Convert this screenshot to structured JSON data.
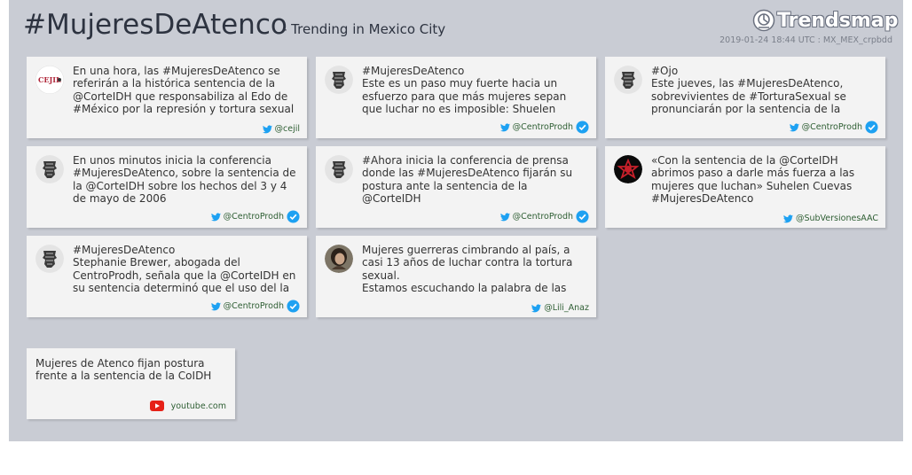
{
  "header": {
    "hashtag": "#MujeresDeAtenco",
    "subtitle": "- Trending in Mexico City",
    "logo_text": "Trendsmap",
    "meta": "2019-01-24 18:44 UTC : MX_MEX_crpbdd"
  },
  "tweets": [
    {
      "avatar": "cejil-logo",
      "lines": [
        " En una hora, las #MujeresDeAtenco se",
        "referirán a la histórica sentencia de la",
        "@CorteIDH que responsabiliza al Edo de",
        "#México por la represión y tortura sexual"
      ],
      "handle": "@cejil",
      "verified": false
    },
    {
      "avatar": "centroprodh-logo",
      "lines": [
        "#MujeresDeAtenco",
        "Este es un paso muy fuerte hacia un",
        "esfuerzo para que más mujeres sepan",
        "que luchar no es imposible: Shuelen"
      ],
      "handle": "@CentroProdh",
      "verified": true
    },
    {
      "avatar": "centroprodh-logo",
      "lines": [
        "#Ojo",
        "Este jueves, las #MujeresDeAtenco,",
        "sobrevivientes de #TorturaSexual se",
        "pronunciarán por la sentencia de la"
      ],
      "handle": "@CentroProdh",
      "verified": true
    },
    {
      "avatar": "centroprodh-logo",
      "lines": [
        "En unos minutos inicia la conferencia",
        "#MujeresDeAtenco, sobre la sentencia de",
        "la @CorteIDH sobre los hechos del 3 y 4",
        "de mayo de 2006"
      ],
      "handle": "@CentroProdh",
      "verified": true
    },
    {
      "avatar": "centroprodh-logo",
      "lines": [
        "#Ahora inicia la conferencia de prensa",
        "donde las #MujeresDeAtenco fijarán su",
        "postura ante la sentencia de la",
        "@CorteIDH"
      ],
      "handle": "@CentroProdh",
      "verified": true
    },
    {
      "avatar": "subversiones-logo",
      "lines": [
        "«Con la sentencia de la @CorteIDH",
        "abrimos paso a darle más fuerza a las",
        "mujeres que luchan» Suhelen Cuevas",
        "#MujeresDeAtenco"
      ],
      "handle": "@SubVersionesAAC",
      "verified": false
    },
    {
      "avatar": "centroprodh-logo",
      "lines": [
        "#MujeresDeAtenco",
        "Stephanie Brewer, abogada del",
        "CentroProdh, señala que la @CorteIDH en",
        "su sentencia determinó que el uso del la"
      ],
      "handle": "@CentroProdh",
      "verified": true
    },
    {
      "avatar": "user-photo",
      "lines": [
        "Mujeres guerreras cimbrando al país, a",
        "casi 13 años de luchar contra la tortura",
        "sexual.",
        "Estamos escuchando la palabra de las"
      ],
      "handle": "@Lili_Anaz",
      "verified": false
    }
  ],
  "video": {
    "lines": [
      "Mujeres de Atenco fijan postura",
      "frente a la sentencia de la CoIDH"
    ],
    "source": "youtube.com"
  },
  "colors": {
    "panel": "#c9ccd4",
    "card": "#f3f3f3",
    "twitter_blue": "#1da1f2",
    "verified": "#1da1f2",
    "youtube_red": "#e62117"
  }
}
